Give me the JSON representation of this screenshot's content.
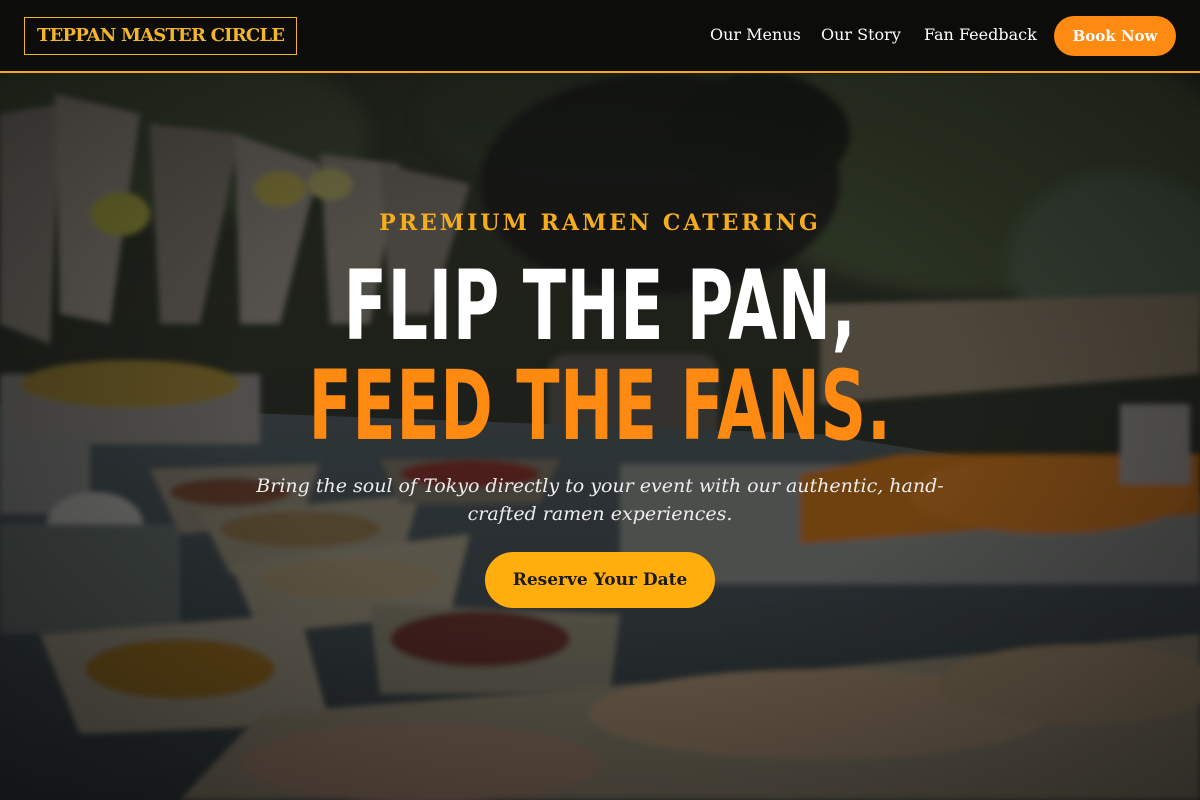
{
  "brand": {
    "logo_text": "TEPPAN MASTER CIRCLE"
  },
  "nav": {
    "links": [
      {
        "label": "Our Menus"
      },
      {
        "label": "Our Story"
      },
      {
        "label": "Fan Feedback"
      }
    ],
    "cta_label": "Book Now"
  },
  "hero": {
    "eyebrow": "PREMIUM RAMEN CATERING",
    "headline_line1": "FLIP THE PAN,",
    "headline_line2": "FEED THE FANS.",
    "subtext": "Bring the soul of Tokyo directly to your event with our authentic, hand-crafted ramen experiences.",
    "cta_label": "Reserve Your Date"
  },
  "colors": {
    "accent_orange": "#ff8a12",
    "accent_gold": "#f5ad1e",
    "cta_yellow": "#ffae0e",
    "header_bg": "#0c0c0b"
  }
}
